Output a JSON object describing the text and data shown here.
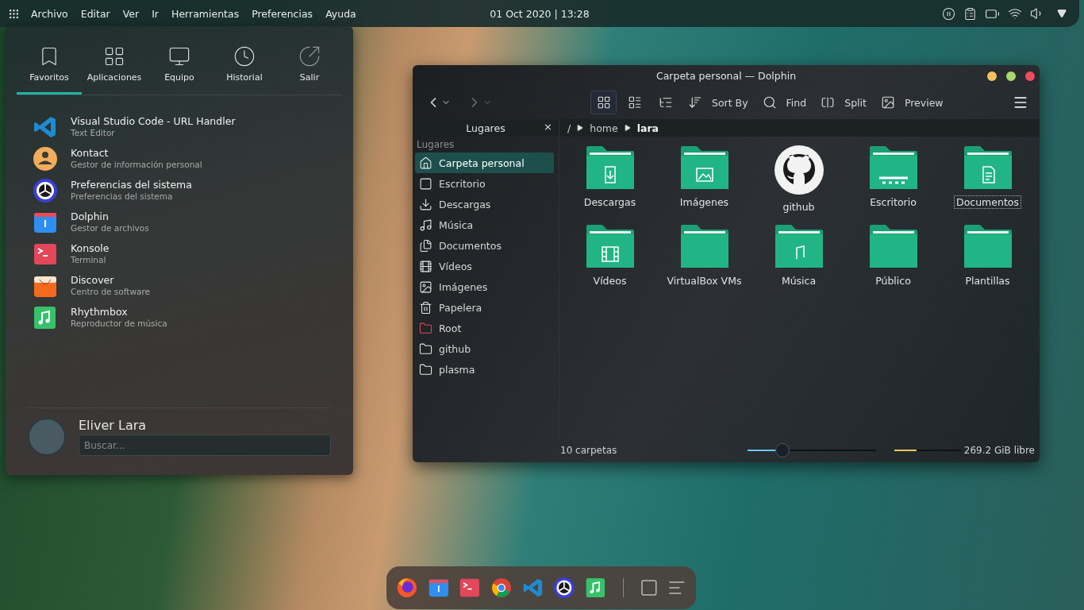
{
  "top_bar": {
    "menu": [
      "Archivo",
      "Editar",
      "Ver",
      "Ir",
      "Herramientas",
      "Preferencias",
      "Ayuda"
    ],
    "clock": "01 Oct 2020 | 13:28"
  },
  "launcher": {
    "tabs": [
      {
        "label": "Favoritos",
        "kind": "bookmark",
        "selected": true
      },
      {
        "label": "Aplicaciones",
        "kind": "grid",
        "selected": false
      },
      {
        "label": "Equipo",
        "kind": "monitor",
        "selected": false
      },
      {
        "label": "Historial",
        "kind": "clock",
        "selected": false
      },
      {
        "label": "Salir",
        "kind": "exit",
        "selected": false
      }
    ],
    "favorites": [
      {
        "name": "Visual Studio Code - URL Handler",
        "description": "Text Editor",
        "kind": "vscode"
      },
      {
        "name": "Kontact",
        "description": "Gestor de información personal",
        "kind": "kontact"
      },
      {
        "name": "Preferencias del sistema",
        "description": "Preferencias del sistema",
        "kind": "settings"
      },
      {
        "name": "Dolphin",
        "description": "Gestor de archivos",
        "kind": "dolphin"
      },
      {
        "name": "Konsole",
        "description": "Terminal",
        "kind": "konsole"
      },
      {
        "name": "Discover",
        "description": "Centro de software",
        "kind": "discover"
      },
      {
        "name": "Rhythmbox",
        "description": "Reproductor de música",
        "kind": "rhythmbox"
      }
    ],
    "user": {
      "name": "Eliver Lara"
    },
    "search": {
      "placeholder": "Buscar..."
    }
  },
  "dolphin": {
    "title": "Carpeta personal — Dolphin",
    "view_modes": [
      {
        "kind": "icons",
        "selected": true
      },
      {
        "kind": "details",
        "selected": false
      },
      {
        "kind": "compact",
        "selected": false
      }
    ],
    "actions": [
      {
        "label": "Sort By",
        "kind": "sort"
      },
      {
        "label": "Find",
        "kind": "find"
      },
      {
        "label": "Split",
        "kind": "split"
      },
      {
        "label": "Preview",
        "kind": "preview"
      }
    ],
    "places_panel": {
      "title": "Lugares",
      "close": "×",
      "section": "Lugares",
      "items": [
        {
          "label": "Carpeta personal",
          "kind": "home",
          "selected": true
        },
        {
          "label": "Escritorio",
          "kind": "desktop",
          "selected": false
        },
        {
          "label": "Descargas",
          "kind": "download",
          "selected": false
        },
        {
          "label": "Música",
          "kind": "music",
          "selected": false
        },
        {
          "label": "Documentos",
          "kind": "documents",
          "selected": false
        },
        {
          "label": "Vídeos",
          "kind": "video",
          "selected": false
        },
        {
          "label": "Imágenes",
          "kind": "image",
          "selected": false
        },
        {
          "label": "Papelera",
          "kind": "trash",
          "selected": false
        },
        {
          "label": "Root",
          "kind": "root",
          "selected": false
        },
        {
          "label": "github",
          "kind": "folder",
          "selected": false
        },
        {
          "label": "plasma",
          "kind": "folder",
          "selected": false
        }
      ]
    },
    "breadcrumb": [
      {
        "label": "/",
        "selected": false
      },
      {
        "label": "home",
        "selected": false
      },
      {
        "label": "lara",
        "selected": true
      }
    ],
    "files": [
      {
        "name": "Descargas",
        "kind": "download",
        "focused": false
      },
      {
        "name": "Imágenes",
        "kind": "image",
        "focused": false
      },
      {
        "name": "github",
        "kind": "github",
        "focused": false
      },
      {
        "name": "Escritorio",
        "kind": "desktop",
        "focused": false
      },
      {
        "name": "Documentos",
        "kind": "documents",
        "focused": true
      },
      {
        "name": "Vídeos",
        "kind": "video",
        "focused": false
      },
      {
        "name": "VirtualBox VMs",
        "kind": "plain",
        "focused": false
      },
      {
        "name": "Música",
        "kind": "music",
        "focused": false
      },
      {
        "name": "Público",
        "kind": "plain",
        "focused": false
      },
      {
        "name": "Plantillas",
        "kind": "plain",
        "focused": false
      }
    ],
    "status": {
      "count": "10 carpetas",
      "zoom": {
        "level": 0.27
      },
      "disk": {
        "level": 0.34
      },
      "free": "269.2 GiB libre"
    }
  },
  "dock": {
    "apps": [
      {
        "kind": "firefox"
      },
      {
        "kind": "dolphin"
      },
      {
        "kind": "konsole"
      },
      {
        "kind": "chrome"
      },
      {
        "kind": "vscode"
      },
      {
        "kind": "settings"
      },
      {
        "kind": "rhythmbox"
      }
    ],
    "extras": [
      {
        "kind": "desktop"
      },
      {
        "kind": "tasks"
      }
    ]
  }
}
